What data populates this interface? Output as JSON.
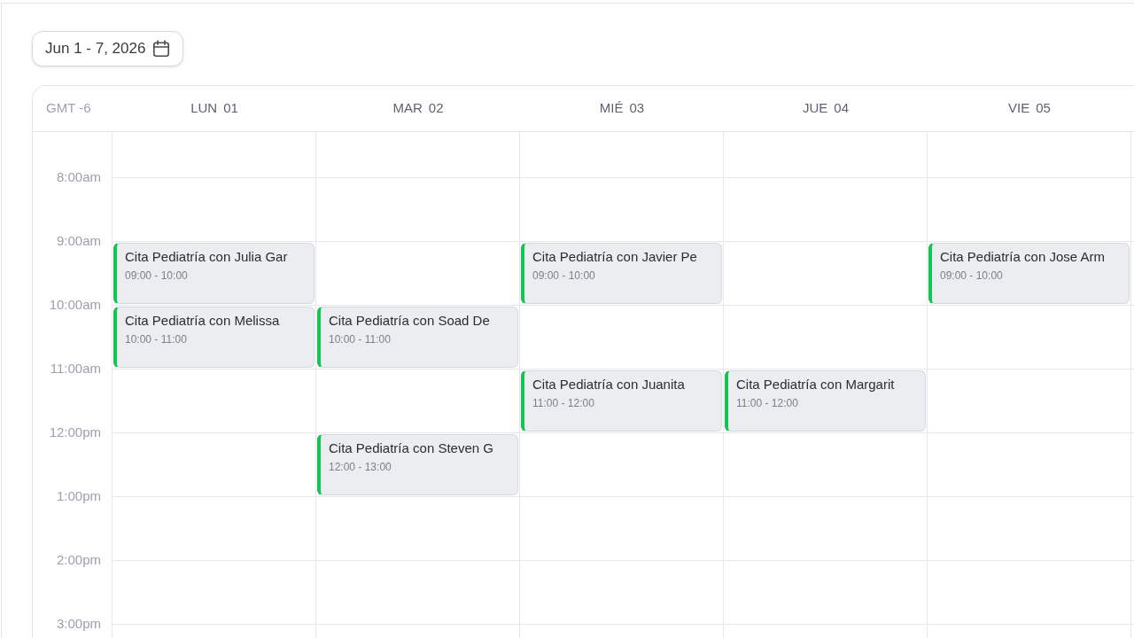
{
  "date_range": {
    "label": "Jun 1 - 7, 2026"
  },
  "calendar": {
    "timezone": "GMT -6",
    "days": [
      {
        "weekday": "LUN",
        "date": "01"
      },
      {
        "weekday": "MAR",
        "date": "02"
      },
      {
        "weekday": "MIÉ",
        "date": "03"
      },
      {
        "weekday": "JUE",
        "date": "04"
      },
      {
        "weekday": "VIE",
        "date": "05"
      }
    ],
    "rows": [
      {
        "time": "8:00am",
        "cells": [
          {
            "kind": "empty"
          },
          {
            "kind": "empty"
          },
          {
            "kind": "empty"
          },
          {
            "kind": "empty"
          },
          {
            "kind": "empty"
          }
        ]
      },
      {
        "time": "9:00am",
        "cells": [
          {
            "kind": "appointment",
            "title": "Cita Pediatría con Julia Gar",
            "time": "09:00 - 10:00"
          },
          {
            "kind": "empty"
          },
          {
            "kind": "appointment",
            "title": "Cita Pediatría con Javier Pe",
            "time": "09:00 - 10:00"
          },
          {
            "kind": "empty"
          },
          {
            "kind": "appointment",
            "title": "Cita Pediatría con Jose Arm",
            "time": "09:00 - 10:00"
          }
        ]
      },
      {
        "time": "10:00am",
        "cells": [
          {
            "kind": "appointment",
            "title": "Cita Pediatría con Melissa",
            "time": "10:00 - 11:00"
          },
          {
            "kind": "appointment",
            "title": "Cita Pediatría con Soad De",
            "time": "10:00 - 11:00"
          },
          {
            "kind": "empty"
          },
          {
            "kind": "empty"
          },
          {
            "kind": "empty"
          }
        ]
      },
      {
        "time": "11:00am",
        "cells": [
          {
            "kind": "empty"
          },
          {
            "kind": "empty"
          },
          {
            "kind": "appointment",
            "title": "Cita Pediatría con Juanita",
            "time": "11:00 - 12:00"
          },
          {
            "kind": "appointment",
            "title": "Cita Pediatría con Margarit",
            "time": "11:00 - 12:00"
          },
          {
            "kind": "empty"
          }
        ]
      },
      {
        "time": "12:00pm",
        "cells": [
          {
            "kind": "empty"
          },
          {
            "kind": "appointment",
            "title": "Cita Pediatría con Steven G",
            "time": "12:00 - 13:00"
          },
          {
            "kind": "empty"
          },
          {
            "kind": "empty"
          },
          {
            "kind": "empty"
          }
        ]
      },
      {
        "time": "1:00pm",
        "cells": [
          {
            "kind": "empty"
          },
          {
            "kind": "empty"
          },
          {
            "kind": "empty"
          },
          {
            "kind": "empty"
          },
          {
            "kind": "empty"
          }
        ]
      },
      {
        "time": "2:00pm",
        "cells": [
          {
            "kind": "empty"
          },
          {
            "kind": "empty"
          },
          {
            "kind": "empty"
          },
          {
            "kind": "empty"
          },
          {
            "kind": "empty"
          }
        ]
      },
      {
        "time": "3:00pm",
        "cells": [
          {
            "kind": "empty"
          },
          {
            "kind": "empty"
          },
          {
            "kind": "empty"
          },
          {
            "kind": "empty"
          },
          {
            "kind": "empty"
          }
        ]
      }
    ]
  }
}
